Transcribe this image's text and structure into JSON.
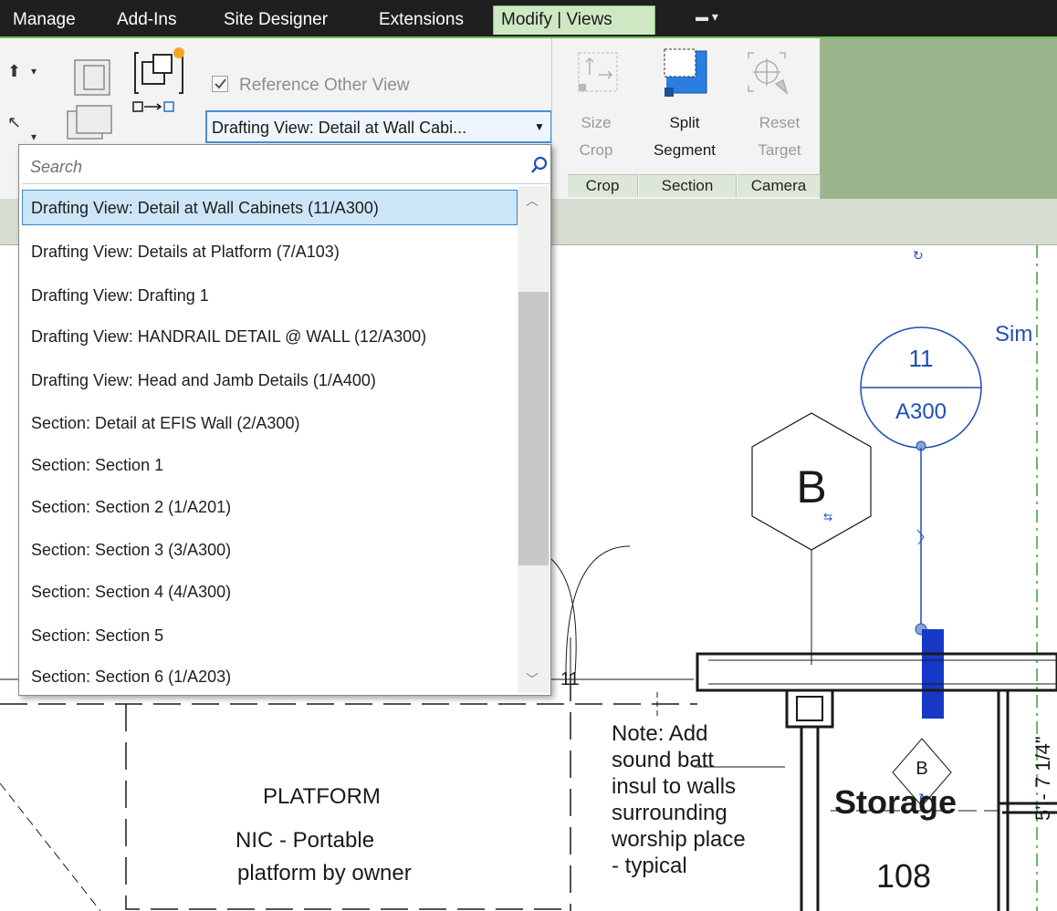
{
  "tabs": [
    "Manage",
    "Add-Ins",
    "Site Designer",
    "Extensions",
    "Modify | Views"
  ],
  "ribbon": {
    "reference_other_view": "Reference Other View",
    "view_combo_value": "Drafting View: Detail at Wall Cabi...",
    "buttons": {
      "size_crop": [
        "Size",
        "Crop"
      ],
      "split_segment": [
        "Split",
        "Segment"
      ],
      "reset_target": [
        "Reset",
        "Target"
      ]
    },
    "panels": [
      "Crop",
      "Section",
      "Camera"
    ]
  },
  "dropdown": {
    "search_placeholder": "Search",
    "items": [
      "Drafting View: Detail at Wall Cabinets (11/A300)",
      "Drafting View: Details at Platform (7/A103)",
      "Drafting View: Drafting 1",
      "Drafting View: HANDRAIL DETAIL @ WALL (12/A300)",
      "Drafting View: Head and Jamb Details (1/A400)",
      "Section: Detail at EFIS Wall (2/A300)",
      "Section: Section 1",
      "Section: Section 2 (1/A201)",
      "Section: Section 3 (3/A300)",
      "Section: Section 4 (4/A300)",
      "Section: Section 5",
      "Section: Section 6 (1/A203)"
    ],
    "selected_index": 0
  },
  "drawing": {
    "sim": "Sim",
    "callout_top": "11",
    "callout_bottom": "A300",
    "hex_label": "B",
    "diamond_label": "B",
    "grid_number": "11",
    "note_lines": [
      "Note: Add",
      "sound batt",
      "insul to walls",
      "surrounding",
      "worship place",
      "- typical"
    ],
    "platform_lines": [
      "PLATFORM",
      "NIC - Portable",
      "platform by owner"
    ],
    "room_name": "Storage",
    "room_number": "108",
    "dim_text": "5' - 7 1/4\""
  },
  "colors": {
    "accent_blue": "#1f4fb5",
    "ribbon_green": "#6fbd5a"
  }
}
